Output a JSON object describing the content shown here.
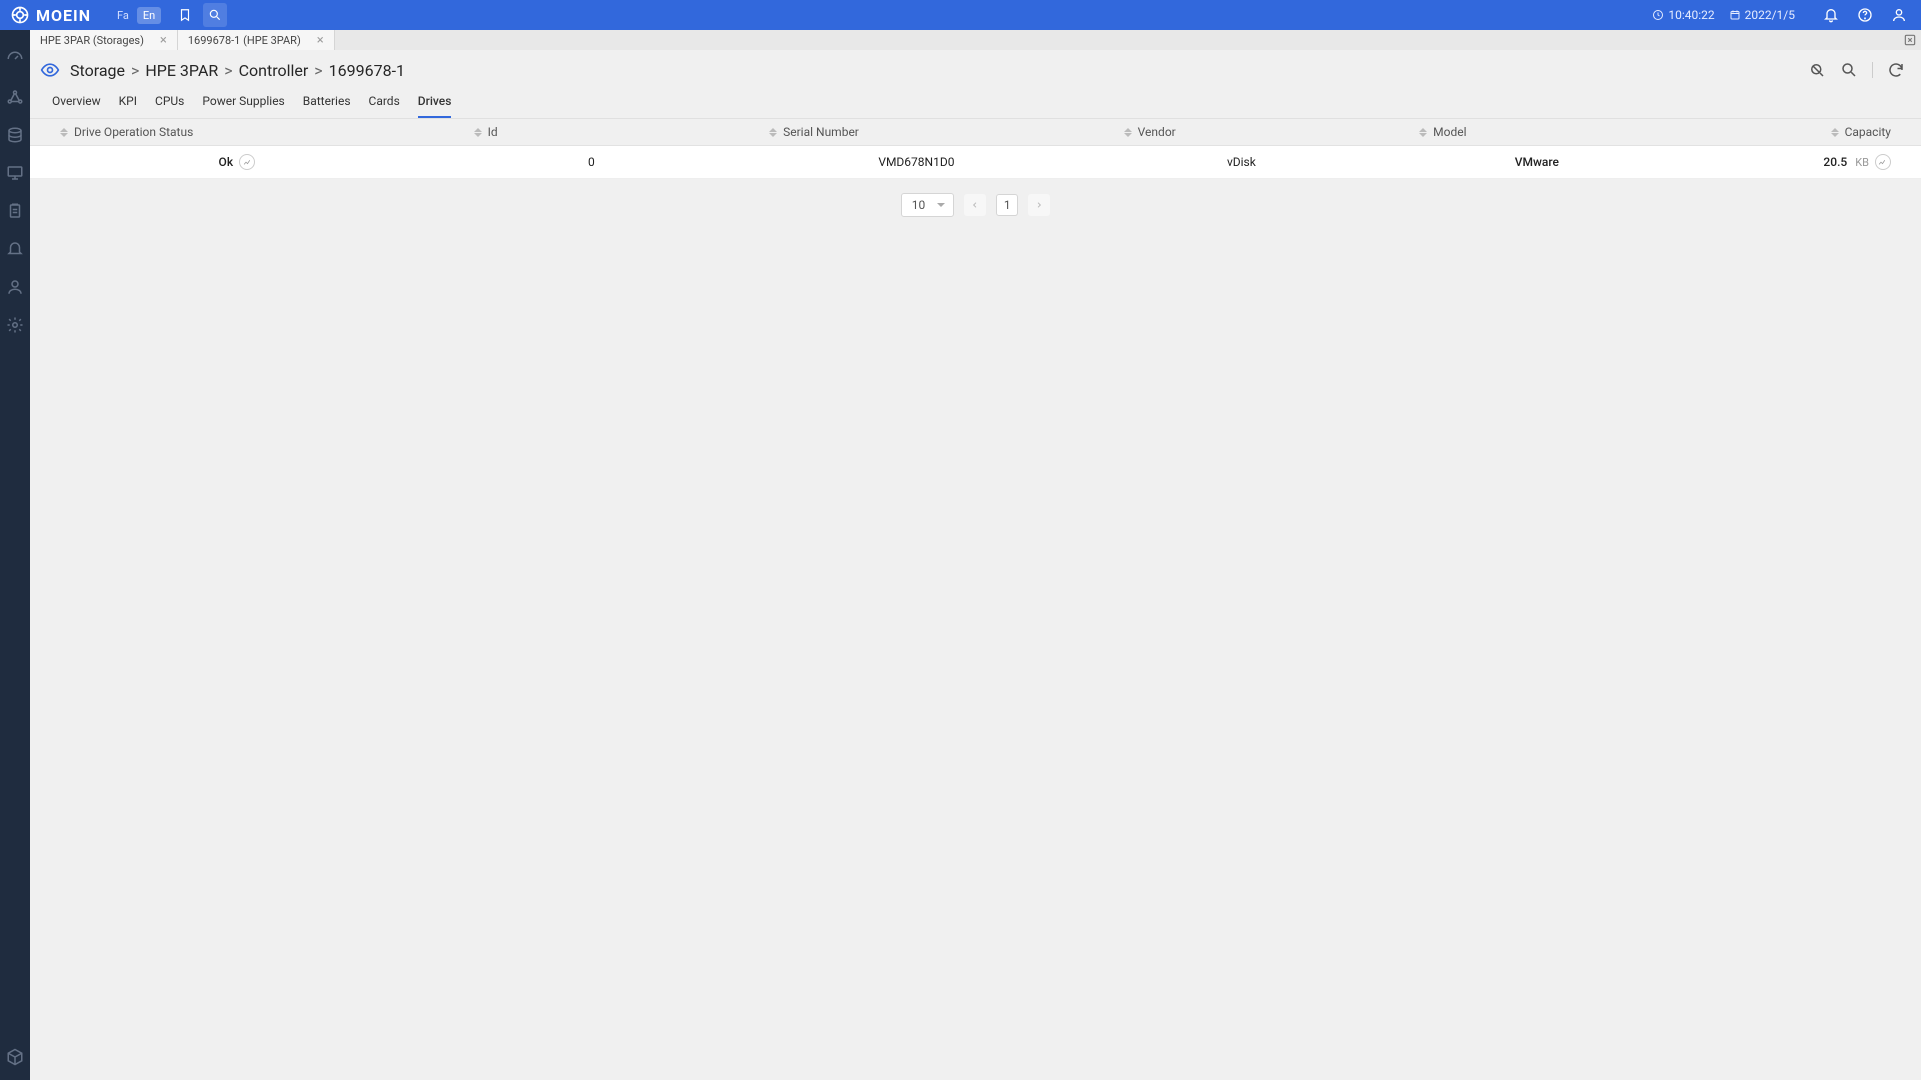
{
  "brand": {
    "name": "MOEIN"
  },
  "lang": {
    "fa": "Fa",
    "en": "En",
    "active": "En"
  },
  "clock": {
    "time": "10:40:22",
    "date": "2022/1/5"
  },
  "tabs": [
    {
      "label": "HPE 3PAR (Storages)"
    },
    {
      "label": "1699678-1 (HPE 3PAR)"
    }
  ],
  "breadcrumb": {
    "p0": "Storage",
    "p1": "HPE 3PAR",
    "p2": "Controller",
    "p3": "1699678-1"
  },
  "subtabs": {
    "overview": "Overview",
    "kpi": "KPI",
    "cpus": "CPUs",
    "ps": "Power Supplies",
    "batt": "Batteries",
    "cards": "Cards",
    "drives": "Drives",
    "active": "Drives"
  },
  "table": {
    "cols": {
      "status": "Drive Operation Status",
      "id": "Id",
      "serial": "Serial Number",
      "vendor": "Vendor",
      "model": "Model",
      "capacity": "Capacity"
    },
    "rows": [
      {
        "status": "Ok",
        "id": "0",
        "serial": "VMD678N1D0",
        "vendor": "vDisk",
        "model": "VMware",
        "capacity_value": "20.5",
        "capacity_unit": "KB"
      }
    ]
  },
  "pagination": {
    "page_size": "10",
    "current": "1"
  }
}
